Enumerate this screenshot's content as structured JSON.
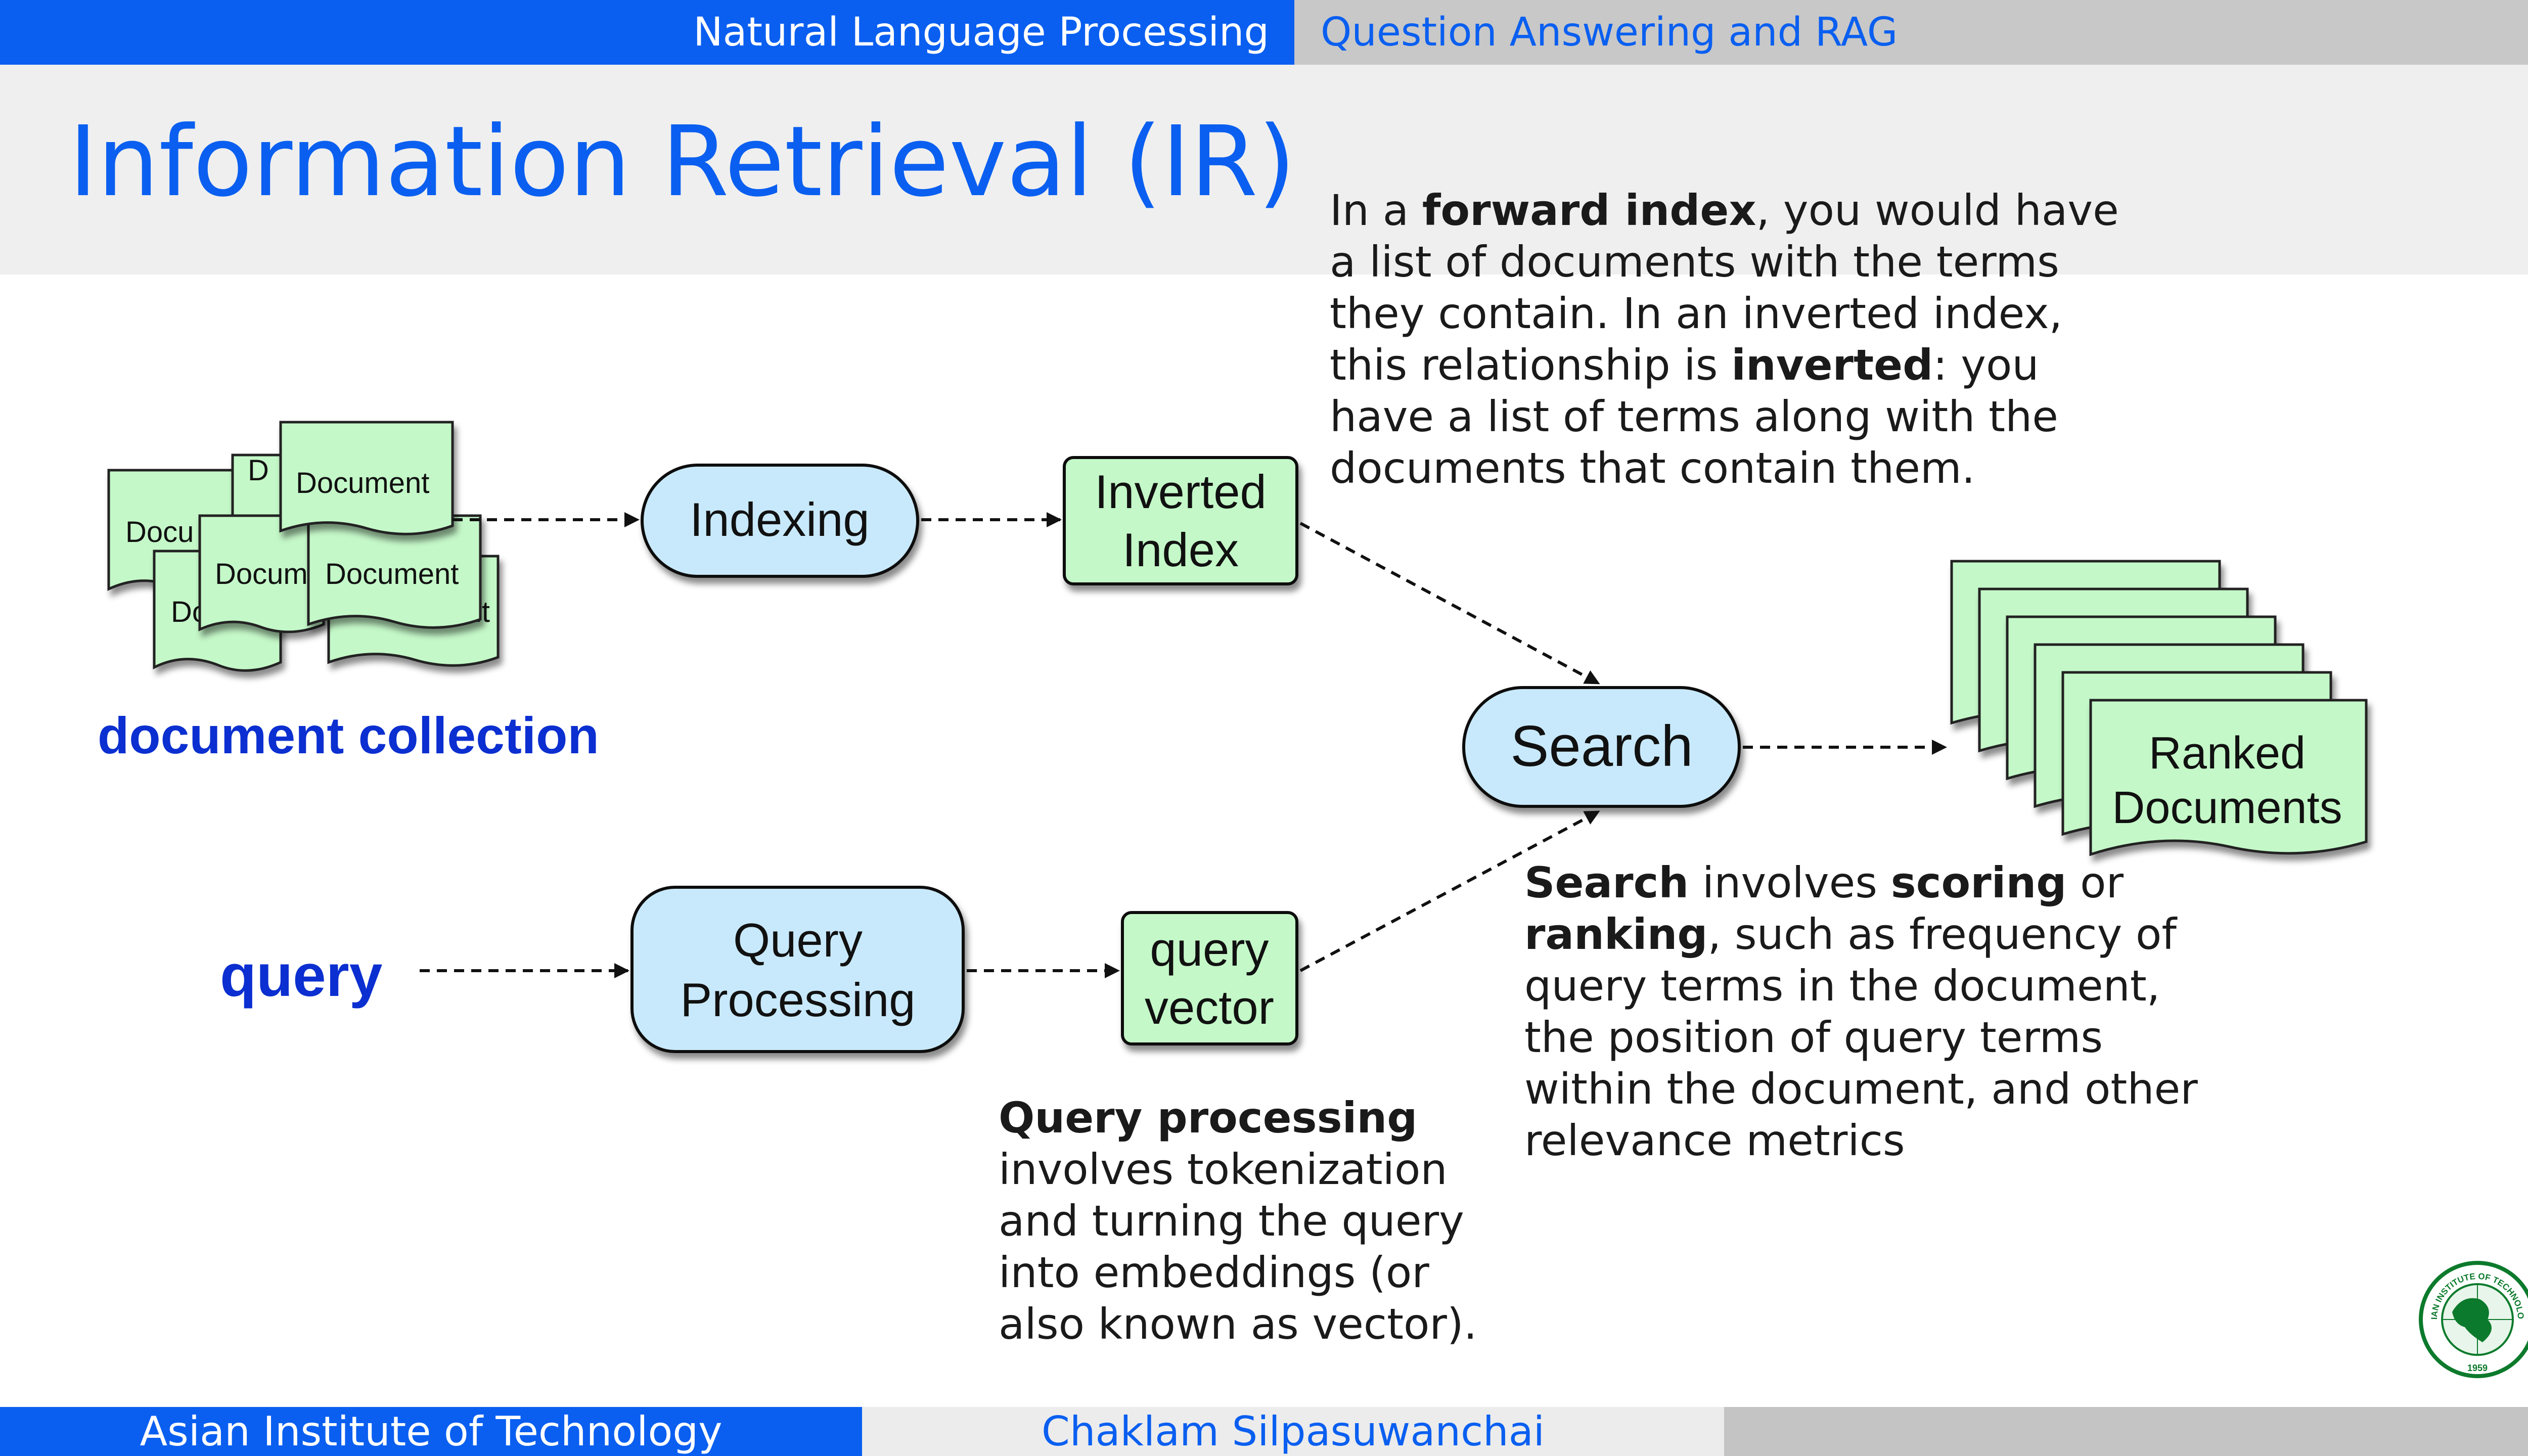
{
  "header": {
    "course": "Natural Language Processing",
    "topic": "Question Answering and RAG"
  },
  "slide": {
    "title": "Information Retrieval (IR)"
  },
  "diagram": {
    "documents": {
      "label": "Document",
      "label_partial_1": "Docu",
      "label_partial_2": "Docum",
      "label_partial_3": "Do",
      "label_partial_4": "ment",
      "label_partial_5": "D",
      "caption": "document collection"
    },
    "indexing": {
      "label": "Indexing"
    },
    "inverted_index": {
      "line1": "Inverted",
      "line2": "Index"
    },
    "search": {
      "label": "Search"
    },
    "ranked": {
      "line1": "Ranked",
      "line2": "Documents"
    },
    "query": {
      "label": "query"
    },
    "query_processing": {
      "line1": "Query",
      "line2": "Processing"
    },
    "query_vector": {
      "line1": "query",
      "line2": "vector"
    }
  },
  "notes": {
    "forward": {
      "p1": "In a ",
      "b1": "forward index",
      "p2": ", you would have a list of documents with the terms they contain. In an inverted index, this relationship is ",
      "b2": "inverted",
      "p3": ": you have a list of terms along with the documents that contain them."
    },
    "search": {
      "b1": "Search",
      "p1": " involves ",
      "b2": "scoring",
      "p2": " or ",
      "b3": "ranking",
      "p3": ", such as frequency of query terms in the document, the position of query terms within the document, and other relevance metrics"
    },
    "query": {
      "b1": "Query processing",
      "p1": "involves tokenization and turning the query into embeddings (or also known as vector)."
    }
  },
  "logo": {
    "text_top": "ASIAN INSTITUTE OF TECHNOLOGY",
    "year": "1959"
  },
  "footer": {
    "institution": "Asian Institute of Technology",
    "author": "Chaklam Silpasuwanchai"
  },
  "colors": {
    "accent_blue": "#0a5ff0",
    "node_blue": "#c8e9fb",
    "doc_green": "#c4f8c8"
  }
}
